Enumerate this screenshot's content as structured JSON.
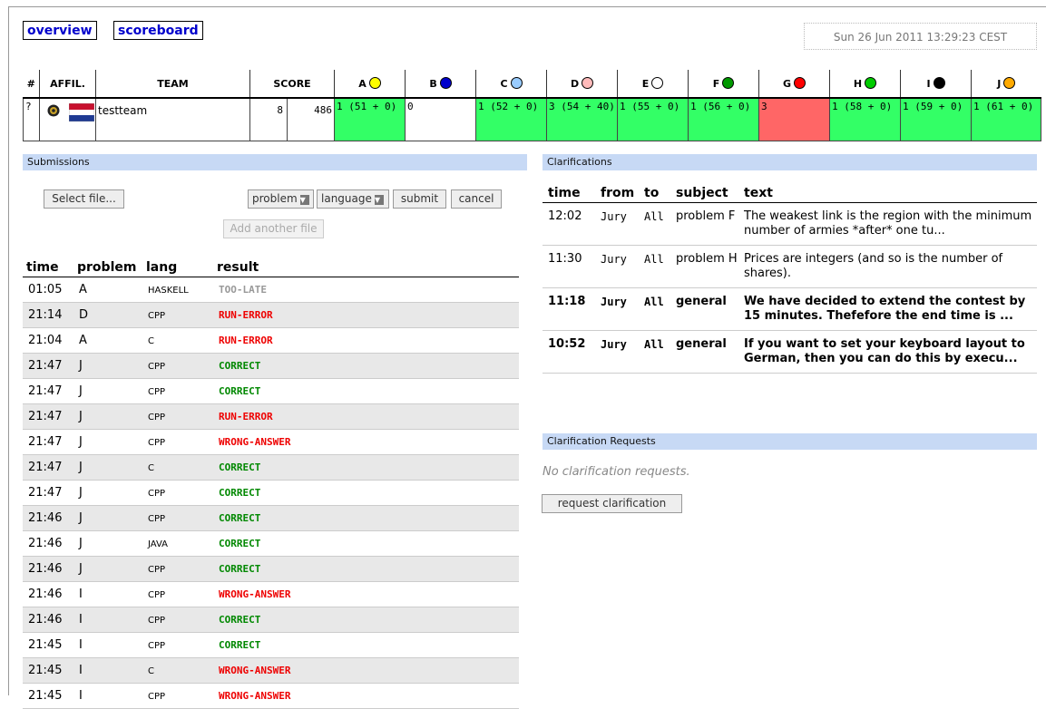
{
  "nav": {
    "overview": "overview",
    "scoreboard": "scoreboard"
  },
  "clock": "Sun 26 Jun 2011 13:29:23 CEST",
  "scoreboard": {
    "headers": {
      "rank": "#",
      "affil": "AFFIL.",
      "team": "TEAM",
      "score": "SCORE"
    },
    "problems": [
      {
        "letter": "A",
        "color": "#ffff00"
      },
      {
        "letter": "B",
        "color": "#0000cc"
      },
      {
        "letter": "C",
        "color": "#99ccff"
      },
      {
        "letter": "D",
        "color": "#ffbbbb"
      },
      {
        "letter": "E",
        "color": "#ffffff"
      },
      {
        "letter": "F",
        "color": "#009900"
      },
      {
        "letter": "G",
        "color": "#ff0000"
      },
      {
        "letter": "H",
        "color": "#00cc00"
      },
      {
        "letter": "I",
        "color": "#000000"
      },
      {
        "letter": "J",
        "color": "#ffaa00"
      }
    ],
    "row": {
      "rank": "?",
      "team": "testteam",
      "solved": "8",
      "time": "486",
      "cells": [
        {
          "text": "1 (51 + 0)",
          "status": "correct"
        },
        {
          "text": "0",
          "status": "none"
        },
        {
          "text": "1 (52 + 0)",
          "status": "correct"
        },
        {
          "text": "3 (54 + 40)",
          "status": "correct"
        },
        {
          "text": "1 (55 + 0)",
          "status": "correct"
        },
        {
          "text": "1 (56 + 0)",
          "status": "correct"
        },
        {
          "text": "3",
          "status": "incorrect"
        },
        {
          "text": "1 (58 + 0)",
          "status": "correct"
        },
        {
          "text": "1 (59 + 0)",
          "status": "correct"
        },
        {
          "text": "1 (61 + 0)",
          "status": "correct"
        }
      ]
    },
    "colors": {
      "correct": "#33ff66",
      "incorrect": "#ff6666",
      "none": "#ffffff"
    }
  },
  "submissions": {
    "title": "Submissions",
    "select_file": "Select file...",
    "problem_select": "problem",
    "language_select": "language",
    "submit": "submit",
    "cancel": "cancel",
    "add_file": "Add another file",
    "columns": {
      "time": "time",
      "problem": "problem",
      "lang": "lang",
      "result": "result"
    },
    "rows": [
      {
        "time": "01:05",
        "problem": "A",
        "lang": "HASKELL",
        "result": "TOO-LATE"
      },
      {
        "time": "21:14",
        "problem": "D",
        "lang": "CPP",
        "result": "RUN-ERROR"
      },
      {
        "time": "21:04",
        "problem": "A",
        "lang": "C",
        "result": "RUN-ERROR"
      },
      {
        "time": "21:47",
        "problem": "J",
        "lang": "CPP",
        "result": "CORRECT"
      },
      {
        "time": "21:47",
        "problem": "J",
        "lang": "CPP",
        "result": "CORRECT"
      },
      {
        "time": "21:47",
        "problem": "J",
        "lang": "CPP",
        "result": "RUN-ERROR"
      },
      {
        "time": "21:47",
        "problem": "J",
        "lang": "CPP",
        "result": "WRONG-ANSWER"
      },
      {
        "time": "21:47",
        "problem": "J",
        "lang": "C",
        "result": "CORRECT"
      },
      {
        "time": "21:47",
        "problem": "J",
        "lang": "CPP",
        "result": "CORRECT"
      },
      {
        "time": "21:46",
        "problem": "J",
        "lang": "CPP",
        "result": "CORRECT"
      },
      {
        "time": "21:46",
        "problem": "J",
        "lang": "JAVA",
        "result": "CORRECT"
      },
      {
        "time": "21:46",
        "problem": "J",
        "lang": "CPP",
        "result": "CORRECT"
      },
      {
        "time": "21:46",
        "problem": "I",
        "lang": "CPP",
        "result": "WRONG-ANSWER"
      },
      {
        "time": "21:46",
        "problem": "I",
        "lang": "CPP",
        "result": "CORRECT"
      },
      {
        "time": "21:45",
        "problem": "I",
        "lang": "CPP",
        "result": "CORRECT"
      },
      {
        "time": "21:45",
        "problem": "I",
        "lang": "C",
        "result": "WRONG-ANSWER"
      },
      {
        "time": "21:45",
        "problem": "I",
        "lang": "CPP",
        "result": "WRONG-ANSWER"
      }
    ],
    "result_colors": {
      "CORRECT": "#008800",
      "RUN-ERROR": "#ee0000",
      "WRONG-ANSWER": "#ee0000",
      "TOO-LATE": "#999999"
    }
  },
  "clarifications": {
    "title": "Clarifications",
    "columns": {
      "time": "time",
      "from": "from",
      "to": "to",
      "subject": "subject",
      "text": "text"
    },
    "rows": [
      {
        "time": "12:02",
        "from": "Jury",
        "to": "All",
        "subject": "problem F",
        "text": "The weakest link is the region with the minimum number of armies *after* one tu...",
        "unread": false
      },
      {
        "time": "11:30",
        "from": "Jury",
        "to": "All",
        "subject": "problem H",
        "text": "Prices are integers (and so is the number of shares).",
        "unread": false
      },
      {
        "time": "11:18",
        "from": "Jury",
        "to": "All",
        "subject": "general",
        "text": "We have decided to extend the contest by 15 minutes. Thefefore the end time is ...",
        "unread": true
      },
      {
        "time": "10:52",
        "from": "Jury",
        "to": "All",
        "subject": "general",
        "text": "If you want to set your keyboard layout to German, then you can do this by execu...",
        "unread": true
      }
    ]
  },
  "requests": {
    "title": "Clarification Requests",
    "empty": "No clarification requests.",
    "button": "request clarification"
  }
}
